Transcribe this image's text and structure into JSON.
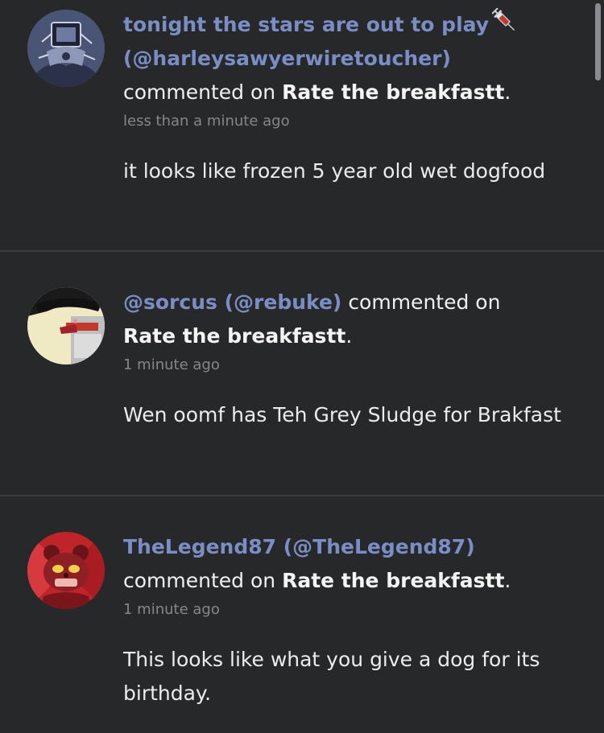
{
  "notifications": [
    {
      "user": "tonight the stars are out to play",
      "icon": "syringe-icon",
      "handle": "(@harleysawyerwiretoucher)",
      "action": "commented on",
      "post_title": "Rate the breakfastt",
      "period": ".",
      "time": "less than a minute ago",
      "comment": "it looks like frozen 5 year old wet dogfood"
    },
    {
      "user": "@sorcus",
      "handle": "(@rebuke)",
      "action": "commented on",
      "post_title": "Rate the breakfastt",
      "period": ".",
      "time": "1 minute ago",
      "comment": "Wen oomf has Teh Grey Sludge for Brakfast"
    },
    {
      "user": "TheLegend87",
      "handle": "(@TheLegend87)",
      "action": "commented on",
      "post_title": "Rate the breakfastt",
      "period": ".",
      "time": "1 minute ago",
      "comment": "This looks like what you give a dog for its birthday."
    }
  ],
  "colors": {
    "background": "#27282a",
    "username": "#7b8dc5",
    "divider": "#3d3e41",
    "timestamp": "#86878b"
  }
}
